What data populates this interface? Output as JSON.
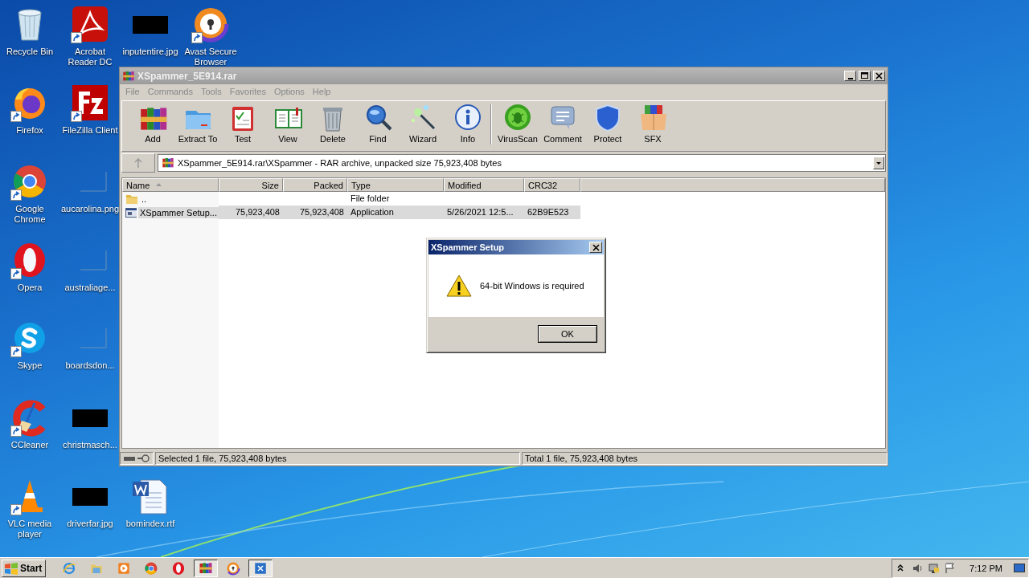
{
  "desktop_icons": [
    {
      "label": "Recycle Bin",
      "kind": "recycle-bin",
      "shortcut": false
    },
    {
      "label": "Firefox",
      "kind": "firefox",
      "shortcut": true
    },
    {
      "label": "Google Chrome",
      "kind": "chrome",
      "shortcut": true
    },
    {
      "label": "Opera",
      "kind": "opera",
      "shortcut": true
    },
    {
      "label": "Skype",
      "kind": "skype",
      "shortcut": true
    },
    {
      "label": "CCleaner",
      "kind": "ccleaner",
      "shortcut": true
    },
    {
      "label": "VLC media player",
      "kind": "vlc",
      "shortcut": true
    },
    {
      "label": "Acrobat Reader DC",
      "kind": "pdf",
      "shortcut": true
    },
    {
      "label": "FileZilla Client",
      "kind": "filezilla",
      "shortcut": true
    },
    {
      "label": "aucarolina.png",
      "kind": "blank-image",
      "shortcut": false
    },
    {
      "label": "australiage...",
      "kind": "blank-image",
      "shortcut": false
    },
    {
      "label": "boardsdon...",
      "kind": "blank-image",
      "shortcut": false
    },
    {
      "label": "christmasch...",
      "kind": "redacted-image",
      "shortcut": false
    },
    {
      "label": "driverfar.jpg",
      "kind": "redacted-image",
      "shortcut": false
    },
    {
      "label": "inputentire.jpg",
      "kind": "redacted-image",
      "shortcut": false
    },
    {
      "label": "bomindex.rtf",
      "kind": "word-doc",
      "shortcut": false
    },
    {
      "label": "Avast Secure Browser",
      "kind": "avast",
      "shortcut": true
    }
  ],
  "window": {
    "title": "XSpammer_5E914.rar",
    "menu": [
      "File",
      "Commands",
      "Tools",
      "Favorites",
      "Options",
      "Help"
    ],
    "toolbar": [
      {
        "label": "Add",
        "kind": "add"
      },
      {
        "label": "Extract To",
        "kind": "extract"
      },
      {
        "label": "Test",
        "kind": "test"
      },
      {
        "label": "View",
        "kind": "view"
      },
      {
        "label": "Delete",
        "kind": "delete"
      },
      {
        "label": "Find",
        "kind": "find"
      },
      {
        "label": "Wizard",
        "kind": "wizard"
      },
      {
        "label": "Info",
        "kind": "info"
      },
      {
        "label": "VirusScan",
        "kind": "virusscan"
      },
      {
        "label": "Comment",
        "kind": "comment"
      },
      {
        "label": "Protect",
        "kind": "protect"
      },
      {
        "label": "SFX",
        "kind": "sfx"
      }
    ],
    "address": "XSpammer_5E914.rar\\XSpammer - RAR archive, unpacked size 75,923,408 bytes",
    "columns": [
      {
        "label": "Name",
        "sorted": true
      },
      {
        "label": "Size",
        "sorted": false
      },
      {
        "label": "Packed",
        "sorted": false
      },
      {
        "label": "Type",
        "sorted": false
      },
      {
        "label": "Modified",
        "sorted": false
      },
      {
        "label": "CRC32",
        "sorted": false
      }
    ],
    "rows": [
      {
        "kind": "folder",
        "name": "..",
        "size": "",
        "packed": "",
        "type": "File folder",
        "modified": "",
        "crc32": "",
        "selected": false
      },
      {
        "kind": "application",
        "name": "XSpammer Setup...",
        "size": "75,923,408",
        "packed": "75,923,408",
        "type": "Application",
        "modified": "5/26/2021 12:5...",
        "crc32": "62B9E523",
        "selected": true
      }
    ],
    "status_bar": {
      "selection": "Selected 1 file, 75,923,408 bytes",
      "total": "Total 1 file, 75,923,408 bytes"
    }
  },
  "dialog": {
    "title": "XSpammer Setup",
    "message": "64-bit Windows is required",
    "button": "OK"
  },
  "taskbar": {
    "start": "Start",
    "items": [
      {
        "kind": "ie",
        "active": false
      },
      {
        "kind": "explorer",
        "active": false
      },
      {
        "kind": "media",
        "active": false
      },
      {
        "kind": "chrome",
        "active": false
      },
      {
        "kind": "opera",
        "active": false
      },
      {
        "kind": "winrar",
        "active": true
      },
      {
        "kind": "avast",
        "active": false
      },
      {
        "kind": "setup",
        "active": true
      }
    ],
    "clock": "7:12 PM"
  }
}
